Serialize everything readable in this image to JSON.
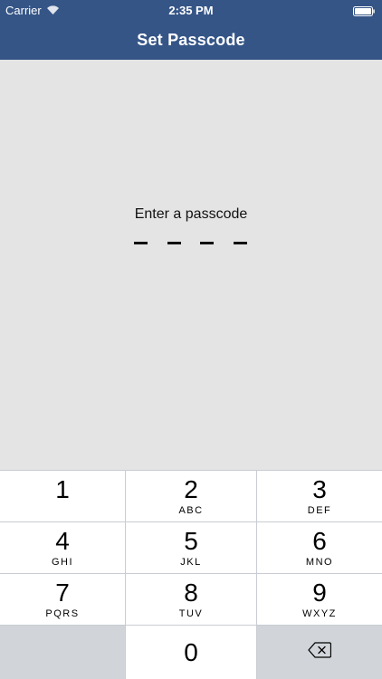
{
  "status_bar": {
    "carrier": "Carrier",
    "time": "2:35 PM"
  },
  "nav": {
    "title": "Set Passcode"
  },
  "passcode": {
    "prompt": "Enter a passcode",
    "length": 4,
    "entered": 0
  },
  "keypad": {
    "keys": [
      {
        "digit": "1",
        "letters": ""
      },
      {
        "digit": "2",
        "letters": "ABC"
      },
      {
        "digit": "3",
        "letters": "DEF"
      },
      {
        "digit": "4",
        "letters": "GHI"
      },
      {
        "digit": "5",
        "letters": "JKL"
      },
      {
        "digit": "6",
        "letters": "MNO"
      },
      {
        "digit": "7",
        "letters": "PQRS"
      },
      {
        "digit": "8",
        "letters": "TUV"
      },
      {
        "digit": "9",
        "letters": "WXYZ"
      },
      {
        "digit": "0",
        "letters": ""
      }
    ]
  },
  "colors": {
    "nav_background": "#355587",
    "content_background": "#e4e4e4",
    "key_background": "#ffffff",
    "key_separator": "#c9ccd2"
  }
}
